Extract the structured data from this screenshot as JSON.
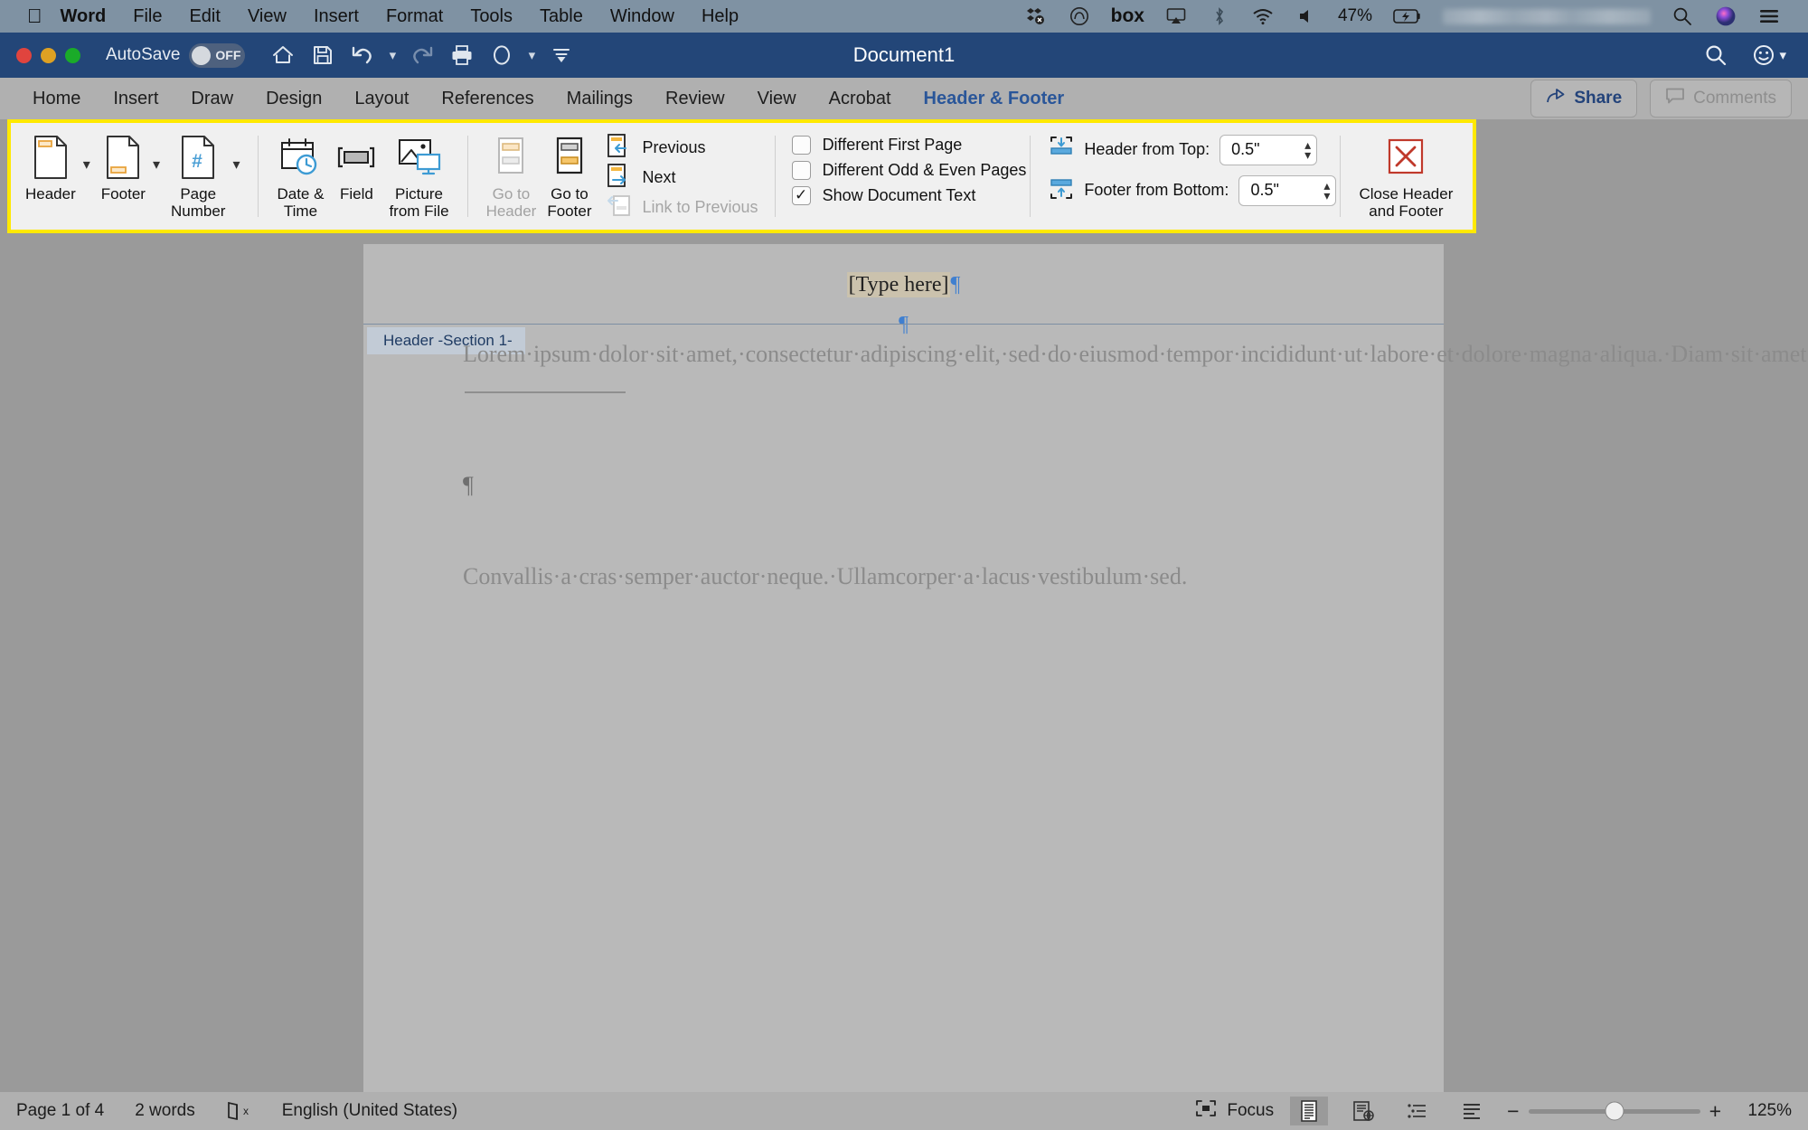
{
  "macbar": {
    "apple_icon": "apple-logo-icon",
    "menus": [
      {
        "label": "Word",
        "bold": true
      },
      {
        "label": "File",
        "bold": false
      },
      {
        "label": "Edit",
        "bold": false
      },
      {
        "label": "View",
        "bold": false
      },
      {
        "label": "Insert",
        "bold": false
      },
      {
        "label": "Format",
        "bold": false
      },
      {
        "label": "Tools",
        "bold": false
      },
      {
        "label": "Table",
        "bold": false
      },
      {
        "label": "Window",
        "bold": false
      },
      {
        "label": "Help",
        "bold": false
      }
    ],
    "tray": {
      "dropbox": "dropbox-icon",
      "creative_cloud": "creative-cloud-icon",
      "box_label": "box",
      "airplay": "airplay-icon",
      "bluetooth": "bluetooth-icon",
      "wifi": "wifi-icon",
      "volume": "volume-icon",
      "battery_percent": "47%",
      "battery": "battery-charging-icon",
      "datetime_blurred": "",
      "search": "spotlight-search-icon",
      "siri": "siri-icon",
      "control_center": "control-center-icon"
    }
  },
  "titlebar": {
    "autosave_label": "AutoSave",
    "autosave_state": "OFF",
    "document_title": "Document1",
    "quick_access": [
      {
        "name": "home-icon"
      },
      {
        "name": "save-icon"
      },
      {
        "name": "undo-icon"
      },
      {
        "name": "redo-icon"
      },
      {
        "name": "print-icon"
      },
      {
        "name": "format-painter-icon"
      },
      {
        "name": "customize-toolbar-icon"
      }
    ],
    "right_icons": [
      {
        "name": "search-icon"
      },
      {
        "name": "smiley-icon"
      }
    ]
  },
  "tabs": [
    {
      "label": "Home",
      "active": false
    },
    {
      "label": "Insert",
      "active": false
    },
    {
      "label": "Draw",
      "active": false
    },
    {
      "label": "Design",
      "active": false
    },
    {
      "label": "Layout",
      "active": false
    },
    {
      "label": "References",
      "active": false
    },
    {
      "label": "Mailings",
      "active": false
    },
    {
      "label": "Review",
      "active": false
    },
    {
      "label": "View",
      "active": false
    },
    {
      "label": "Acrobat",
      "active": false
    },
    {
      "label": "Header & Footer",
      "active": true
    }
  ],
  "tabbar_actions": {
    "share_label": "Share",
    "comments_label": "Comments"
  },
  "ribbon": {
    "highlight_color": "#ffe900",
    "insert_group": [
      {
        "label": "Header",
        "icon": "header-page-icon",
        "has_dropdown": true,
        "disabled": false
      },
      {
        "label": "Footer",
        "icon": "footer-page-icon",
        "has_dropdown": true,
        "disabled": false
      },
      {
        "label": "Page\nNumber",
        "label_line1": "Page",
        "label_line2": "Number",
        "icon": "page-number-icon",
        "has_dropdown": true,
        "disabled": false
      }
    ],
    "insert_items": [
      {
        "label_line1": "Date &",
        "label_line2": "Time",
        "icon": "date-time-icon"
      },
      {
        "label_line1": "Field",
        "label_line2": "",
        "icon": "field-icon"
      },
      {
        "label_line1": "Picture",
        "label_line2": "from File",
        "icon": "picture-from-file-icon"
      }
    ],
    "navigation": [
      {
        "label_line1": "Go to",
        "label_line2": "Header",
        "icon": "go-to-header-icon",
        "disabled": true
      },
      {
        "label_line1": "Go to",
        "label_line2": "Footer",
        "icon": "go-to-footer-icon",
        "disabled": false
      }
    ],
    "nav_small": [
      {
        "label": "Previous",
        "icon": "previous-section-icon",
        "disabled": false
      },
      {
        "label": "Next",
        "icon": "next-section-icon",
        "disabled": false
      },
      {
        "label": "Link to Previous",
        "icon": "link-to-previous-icon",
        "disabled": true
      }
    ],
    "options": [
      {
        "label": "Different First Page",
        "checked": false
      },
      {
        "label": "Different Odd & Even Pages",
        "checked": false
      },
      {
        "label": "Show Document Text",
        "checked": true
      }
    ],
    "positions": [
      {
        "label": "Header from Top:",
        "value": "0.5\"",
        "icon": "header-from-top-icon"
      },
      {
        "label": "Footer from Bottom:",
        "value": "0.5\"",
        "icon": "footer-from-bottom-icon"
      }
    ],
    "close_button": {
      "label_line1": "Close Header",
      "label_line2": "and Footer",
      "icon": "close-header-footer-icon"
    }
  },
  "document": {
    "header_placeholder": "[Type here]",
    "pilcrow": "¶",
    "header_tag": "Header -Section 1-",
    "paragraph1": "Lorem·ipsum·dolor·sit·amet,·consectetur·adipiscing·elit,·sed·do·eiusmod·tempor·incididunt·ut·labore·et·dolore·magna·aliqua.·Diam·sit·amet·nisl·suscipit·adipiscing.·Gravida·in·fermentum·et·sollicitudin.·Sem·viverra·aliquet·eget·sit·amet·tellus·cras·adipiscing·enim.·Sed·egestas·egestas·fringilla·phasellus.·Tristique·senectus·et·netus·et·malesuada·fames·ac·turpis.·A·scelerisque·purus·semper·eget·duis·at·tellus·at.·Adipiscing·elit·pellentesque·habitant·morbi·tristique·senectus.·Felis·bibendum·ut·tristique·et·egestas·quis·ipsum.·Integer·feugiat·scelerisque·varius·morbi·enim·nunc.·Nunc·consequat·interdum·varius·sit·amet·mattis.·Facilisis·magna·etiam·tempor·orci·eu·lobortis·elementum·nibh.·Porttitor·leo·a·diam·sollicitudin·tempor·id·eu·nisl·nunc.·Gravida·in·fermentum·et·sollicitudin·ac·orci·phasellus·egestas·tellus.·Dapibus·ultrices·in·iaculis·nunc·sed.·Placerat·vestibulum·lectus·mauris·ultrices·eros·in·cursus·turpis.·Dui·vivamus·arcu·felis·bibendum·ut·tristique.·Ligula·ullamcorper·malesuada·proin·libero·nunc·consequat.·Tellus·molestie·nunc·non·blandit·massa·enim",
    "paragraph2": "Convallis·a·cras·semper·auctor·neque.·Ullamcorper·a·lacus·vestibulum·sed."
  },
  "statusbar": {
    "page_label": "Page 1 of 4",
    "word_count": "2 words",
    "proofing_icon": "proofing-errors-icon",
    "language": "English (United States)",
    "focus_label": "Focus",
    "views": [
      {
        "name": "print-layout-view-icon",
        "active": true
      },
      {
        "name": "web-layout-view-icon",
        "active": false
      },
      {
        "name": "outline-view-icon",
        "active": false
      },
      {
        "name": "draft-view-icon",
        "active": false
      }
    ],
    "zoom_minus": "−",
    "zoom_plus": "+",
    "zoom_level": "125%",
    "zoom_slider_percent": 50
  }
}
